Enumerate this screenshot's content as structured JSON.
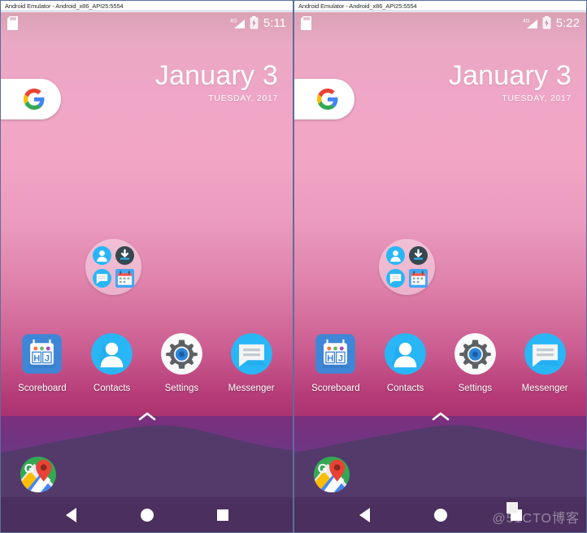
{
  "window": {
    "title": "Android Emulator - Android_x86_API25:5554"
  },
  "screens": [
    {
      "id": "left",
      "status_bar": {
        "sd_icon": "sd-card-icon",
        "network_label": "4G",
        "signal_icon": "signal-bars-icon",
        "battery_icon": "battery-charging-icon",
        "clock": "5:11"
      },
      "date_widget": {
        "date": "January 3",
        "subtitle": "TUESDAY, 2017"
      }
    },
    {
      "id": "right",
      "status_bar": {
        "sd_icon": "sd-card-icon",
        "network_label": "4G",
        "signal_icon": "signal-bars-icon",
        "battery_icon": "battery-charging-icon",
        "clock": "5:22"
      },
      "date_widget": {
        "date": "January 3",
        "subtitle": "TUESDAY, 2017"
      }
    }
  ],
  "search_widget": {
    "icon": "google-g-icon"
  },
  "folder": {
    "name": "app-folder",
    "items": [
      {
        "icon": "contacts-icon"
      },
      {
        "icon": "downloads-icon"
      },
      {
        "icon": "messaging-icon"
      },
      {
        "icon": "calendar-icon"
      }
    ]
  },
  "apps": [
    {
      "label": "Scoreboard",
      "icon": "scoreboard-icon"
    },
    {
      "label": "Contacts",
      "icon": "contacts-icon"
    },
    {
      "label": "Settings",
      "icon": "settings-gear-icon"
    },
    {
      "label": "Messenger",
      "icon": "messenger-icon"
    }
  ],
  "drawer_handle": {
    "icon": "chevron-up-icon"
  },
  "dock": [
    {
      "icon": "google-maps-icon"
    }
  ],
  "nav_bar": {
    "back": "back-triangle-icon",
    "home": "home-circle-icon",
    "recents": "recents-square-icon"
  },
  "watermark": {
    "text": "@51CTO博客"
  },
  "colors": {
    "wallpaper_top": "#f0a6c6",
    "wallpaper_mid": "#cc5f92",
    "wallpaper_bottom": "#6b2b75",
    "mountain": "#533a6b",
    "navbar": "#4b2f5e",
    "accent_blue": "#29b6f6",
    "google_blue": "#4285f4",
    "google_red": "#ea4335",
    "google_yellow": "#fbbc05",
    "google_green": "#34a853"
  }
}
